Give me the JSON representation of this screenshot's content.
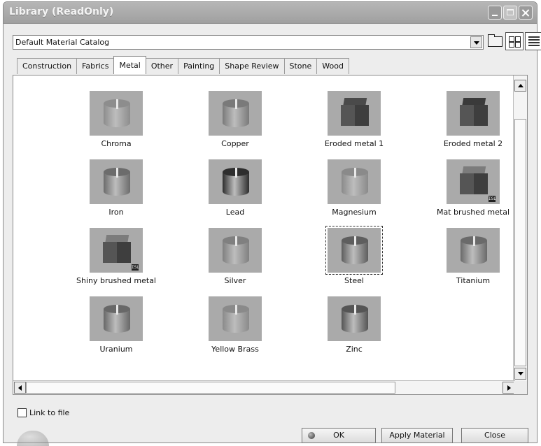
{
  "window": {
    "title": "Library (ReadOnly)"
  },
  "catalog": {
    "selected": "Default Material Catalog"
  },
  "toolbar_icons": [
    "folder-icon",
    "icons-view-icon",
    "list-view-icon"
  ],
  "tabs": [
    {
      "label": "Construction",
      "active": false
    },
    {
      "label": "Fabrics",
      "active": false
    },
    {
      "label": "Metal",
      "active": true
    },
    {
      "label": "Other",
      "active": false
    },
    {
      "label": "Painting",
      "active": false
    },
    {
      "label": "Shape Review",
      "active": false
    },
    {
      "label": "Stone",
      "active": false
    },
    {
      "label": "Wood",
      "active": false
    }
  ],
  "materials": [
    {
      "label": "Chroma",
      "shape": "cylinder",
      "color": "#8d8d8d"
    },
    {
      "label": "Copper",
      "shape": "cylinder",
      "color": "#7a7a7a"
    },
    {
      "label": "Eroded metal 1",
      "shape": "cube",
      "color": "#4a4a4a"
    },
    {
      "label": "Eroded metal 2",
      "shape": "cube",
      "color": "#3a3a3a"
    },
    {
      "label": "Iron",
      "shape": "cylinder",
      "color": "#6c6c6c"
    },
    {
      "label": "Lead",
      "shape": "cylinder",
      "color": "#2e2e2e"
    },
    {
      "label": "Magnesium",
      "shape": "cylinder",
      "color": "#8a8a8a"
    },
    {
      "label": "Mat brushed metal",
      "shape": "cube",
      "color": "#7c7c7c",
      "badge": "ISL"
    },
    {
      "label": "Shiny brushed metal",
      "shape": "cube",
      "color": "#7c7c7c",
      "badge": "ISL"
    },
    {
      "label": "Silver",
      "shape": "cylinder",
      "color": "#808080"
    },
    {
      "label": "Steel",
      "shape": "cylinder",
      "color": "#5e5e5e",
      "selected": true
    },
    {
      "label": "Titanium",
      "shape": "cylinder",
      "color": "#6a6a6a"
    },
    {
      "label": "Uranium",
      "shape": "cylinder",
      "color": "#686868"
    },
    {
      "label": "Yellow Brass",
      "shape": "cylinder",
      "color": "#8a8a8a"
    },
    {
      "label": "Zinc",
      "shape": "cylinder",
      "color": "#555555"
    }
  ],
  "link_to_file": {
    "label": "Link to file",
    "checked": false
  },
  "buttons": {
    "ok": "OK",
    "apply": "Apply Material",
    "close": "Close"
  }
}
